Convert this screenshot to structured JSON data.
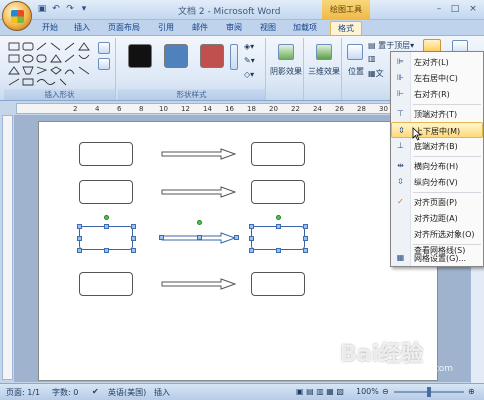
{
  "titlebar": {
    "title": "文档 2 - Microsoft Word",
    "tools_label": "绘图工具",
    "window_buttons": [
      "–",
      "□",
      "×"
    ]
  },
  "tabs": [
    "开始",
    "插入",
    "页面布局",
    "引用",
    "邮件",
    "审阅",
    "视图",
    "加载项",
    "格式"
  ],
  "active_tab": "格式",
  "ribbon": {
    "groups": {
      "insert_shapes": "插入形状",
      "shape_styles": "形状样式",
      "shadow": "阴影效果",
      "threed": "三维效果",
      "position": "位置",
      "arrange_partial": "文"
    },
    "bring_front": "置于顶层",
    "swatch_colors": [
      "#111111",
      "#4f81bd",
      "#c0504d"
    ]
  },
  "ruler_numbers": [
    "2",
    "4",
    "6",
    "8",
    "10",
    "12",
    "14",
    "16",
    "18",
    "20",
    "22",
    "24",
    "26",
    "28",
    "30"
  ],
  "menu": {
    "items": [
      {
        "label": "左对齐(L)",
        "icon": "align-left-icon",
        "glyph": "⊫"
      },
      {
        "label": "左右居中(C)",
        "icon": "align-center-icon",
        "glyph": "⊪"
      },
      {
        "label": "右对齐(R)",
        "icon": "align-right-icon",
        "glyph": "⊩"
      },
      {
        "label": "顶端对齐(T)",
        "icon": "align-top-icon",
        "glyph": "⊤"
      },
      {
        "label": "上下居中(M)",
        "icon": "align-middle-icon",
        "glyph": "⇕",
        "highlighted": true
      },
      {
        "label": "底端对齐(B)",
        "icon": "align-bottom-icon",
        "glyph": "⊥"
      },
      {
        "label": "横向分布(H)",
        "icon": "distribute-horizontal-icon",
        "glyph": "⇹"
      },
      {
        "label": "纵向分布(V)",
        "icon": "distribute-vertical-icon",
        "glyph": "⇳"
      },
      {
        "label": "对齐页面(P)",
        "icon": "check-icon",
        "glyph": "✓"
      },
      {
        "label": "对齐边距(A)",
        "icon": "",
        "glyph": ""
      },
      {
        "label": "对齐所选对象(O)",
        "icon": "",
        "glyph": ""
      },
      {
        "label": "查看网格线(S)",
        "icon": "",
        "glyph": ""
      },
      {
        "label": "网格设置(G)...",
        "icon": "grid-settings-icon",
        "glyph": "▦"
      }
    ]
  },
  "statusbar": {
    "page": "页面: 1/1",
    "words": "字数: 0",
    "language": "英语(美国)",
    "mode": "插入",
    "zoom": "100%"
  },
  "watermark": {
    "text": "Bai经验",
    "url": "jingyan.baidu.com"
  }
}
